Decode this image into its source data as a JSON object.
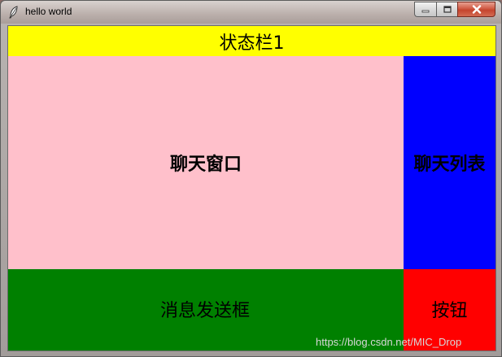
{
  "window": {
    "title": "hello world",
    "icon": "feather-icon"
  },
  "controls": {
    "minimize_icon": "minimize-icon",
    "maximize_icon": "maximize-icon",
    "close_icon": "close-icon"
  },
  "panes": {
    "status_bar": "状态栏1",
    "chat_window": "聊天窗口",
    "chat_list": "聊天列表",
    "message_input": "消息发送框",
    "send_button": "按钮"
  },
  "colors": {
    "status_bar": "#ffff00",
    "chat_window": "#ffc0cb",
    "chat_list": "#0000ff",
    "message_input": "#008000",
    "send_button": "#ff0000"
  },
  "watermark": "https://blog.csdn.net/MIC_Drop"
}
